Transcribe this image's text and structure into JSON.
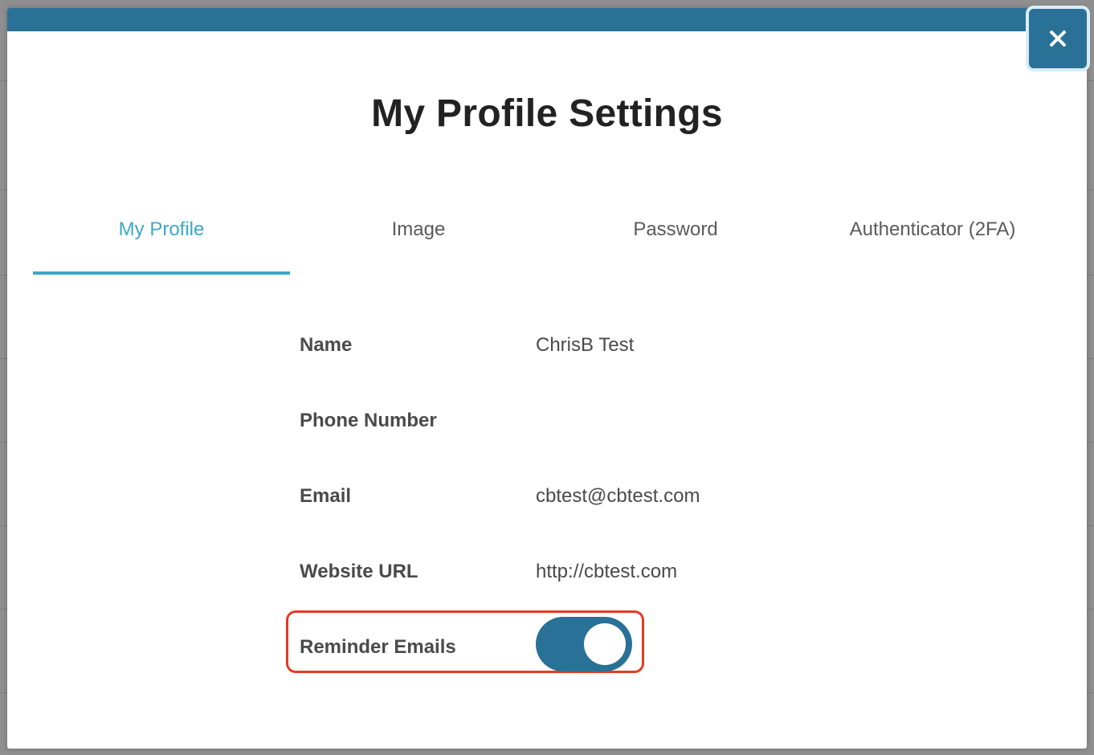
{
  "modal": {
    "title": "My Profile Settings",
    "close_label": "✕"
  },
  "tabs": [
    {
      "label": "My Profile",
      "active": true
    },
    {
      "label": "Image",
      "active": false
    },
    {
      "label": "Password",
      "active": false
    },
    {
      "label": "Authenticator (2FA)",
      "active": false
    }
  ],
  "profile": {
    "name": {
      "label": "Name",
      "value": "ChrisB Test"
    },
    "phone": {
      "label": "Phone Number",
      "value": ""
    },
    "email": {
      "label": "Email",
      "value": "cbtest@cbtest.com"
    },
    "website": {
      "label": "Website URL",
      "value": "http://cbtest.com"
    },
    "reminder": {
      "label": "Reminder Emails",
      "enabled": true
    }
  },
  "colors": {
    "primary": "#2a7197",
    "tab_active": "#3ba8c8",
    "highlight": "#e23c22"
  }
}
